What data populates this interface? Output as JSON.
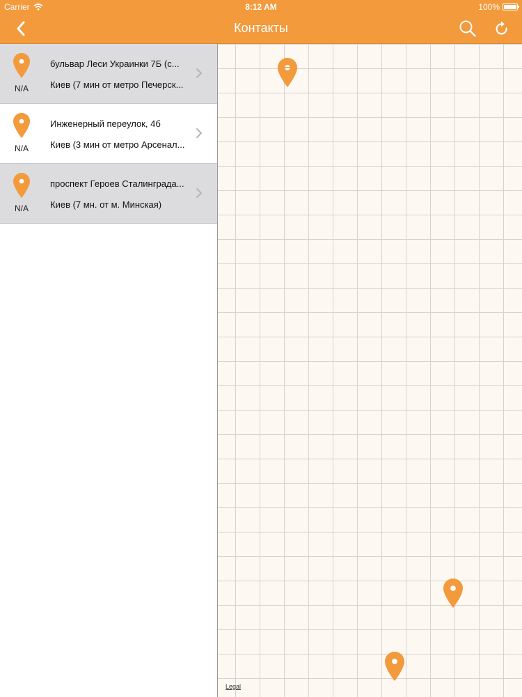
{
  "status_bar": {
    "carrier": "Carrier",
    "time": "8:12 AM",
    "battery": "100%"
  },
  "nav": {
    "title": "Контакты",
    "back_icon": "chevron-left-icon",
    "search_icon": "search-icon",
    "refresh_icon": "refresh-icon"
  },
  "colors": {
    "accent": "#f29a3c",
    "row_grey": "#dcdcdf",
    "map_bg": "#fdf8f1"
  },
  "locations": [
    {
      "address": "бульвар Леси Украинки 7Б (с...",
      "city_line": "Киев (7 мин от метро Печерск...",
      "distance": "N/A"
    },
    {
      "address": "Инженерный переулок, 4б",
      "city_line": "Киев (3 мин от метро Арсенал...",
      "distance": "N/A"
    },
    {
      "address": "проспект Героев Сталинграда...",
      "city_line": "Киев (7 мн. от м. Минская)",
      "distance": "N/A"
    }
  ],
  "map": {
    "legal": "Legal"
  }
}
